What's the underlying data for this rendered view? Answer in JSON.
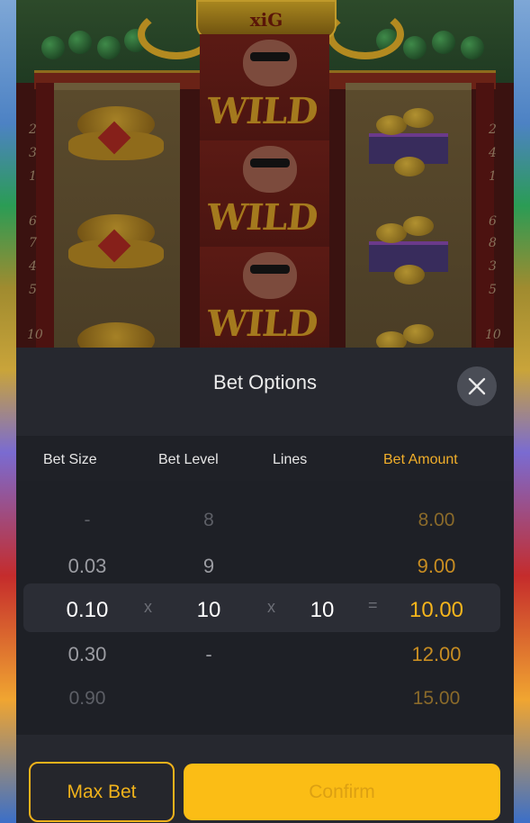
{
  "game": {
    "logo": "xiG",
    "wild_label": "WILD",
    "left_numbers": [
      "2",
      "3",
      "1",
      "6",
      "7",
      "4",
      "5",
      "10"
    ],
    "right_numbers": [
      "2",
      "4",
      "1",
      "6",
      "8",
      "3",
      "5",
      "10"
    ]
  },
  "modal": {
    "title": "Bet Options",
    "columns": {
      "bet_size": "Bet Size",
      "bet_level": "Bet Level",
      "lines": "Lines",
      "bet_amount": "Bet Amount"
    },
    "bet_size_options": [
      "-",
      "0.03",
      "0.10",
      "0.30",
      "0.90"
    ],
    "bet_level_options": [
      "8",
      "9",
      "10",
      "-"
    ],
    "lines_value": "10",
    "bet_amount_options": [
      "8.00",
      "9.00",
      "10.00",
      "12.00",
      "15.00"
    ],
    "operator_multiply": "x",
    "operator_equals": "=",
    "selected": {
      "bet_size": "0.10",
      "bet_level": "10",
      "lines": "10",
      "bet_amount": "10.00"
    },
    "max_bet_label": "Max Bet",
    "confirm_label": "Confirm"
  },
  "colors": {
    "accent": "#f6b51c",
    "panel_bg": "#26282f",
    "confirm_bg": "#fbbd15"
  }
}
